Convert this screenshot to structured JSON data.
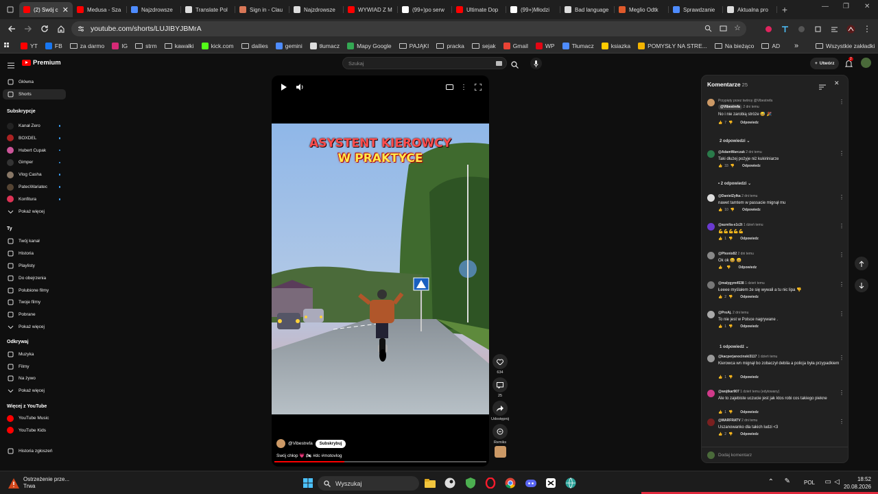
{
  "browser": {
    "tabs": [
      {
        "title": "(2) Swój c",
        "color": "#ff0000",
        "active": true
      },
      {
        "title": "Medusa - Sza",
        "color": "#ff0000"
      },
      {
        "title": "Najzdrowsze",
        "color": "#4e8cff"
      },
      {
        "title": "Translate Pol",
        "color": "#dddddd"
      },
      {
        "title": "Sign in - Clau",
        "color": "#d97757"
      },
      {
        "title": "Najzdrowsze",
        "color": "#dddddd"
      },
      {
        "title": "WYWIAD Z M",
        "color": "#ff0000"
      },
      {
        "title": "(99+)po serw",
        "color": "#ffffff"
      },
      {
        "title": "Ultimate Dop",
        "color": "#ff0000"
      },
      {
        "title": "(99+)Młodzi",
        "color": "#ffffff"
      },
      {
        "title": "Bad language",
        "color": "#dddddd"
      },
      {
        "title": "Meglio Odtk",
        "color": "#e05a2b"
      },
      {
        "title": "Sprawdzanie",
        "color": "#4e8cff"
      },
      {
        "title": "Aktualna pro",
        "color": "#dddddd"
      }
    ],
    "url": "youtube.com/shorts/LUJIBYJBMrA",
    "bookmarks": [
      {
        "label": "YT",
        "color": "#ff0000"
      },
      {
        "label": "FB",
        "color": "#1877f2"
      },
      {
        "label": "za darmo",
        "folder": true
      },
      {
        "label": "IG",
        "color": "#d62976"
      },
      {
        "label": "strm",
        "folder": true
      },
      {
        "label": "kawałki",
        "folder": true
      },
      {
        "label": "kick.com",
        "color": "#53fc18"
      },
      {
        "label": "dailies",
        "folder": true
      },
      {
        "label": "gemini",
        "color": "#4e8cff"
      },
      {
        "label": "tłumacz",
        "color": "#dddddd"
      },
      {
        "label": "Mapy Google",
        "color": "#34a853"
      },
      {
        "label": "PAJĄKI",
        "folder": true
      },
      {
        "label": "pracka",
        "folder": true
      },
      {
        "label": "sejak",
        "folder": true
      },
      {
        "label": "Gmail",
        "color": "#ea4335"
      },
      {
        "label": "WP",
        "color": "#e30613"
      },
      {
        "label": "Tłumacz",
        "color": "#4e8cff"
      },
      {
        "label": "ksiazka",
        "color": "#ffcc00"
      },
      {
        "label": "POMYSŁY NA STRE...",
        "color": "#f4b400"
      },
      {
        "label": "Na bieżąco",
        "folder": true
      },
      {
        "label": "AD",
        "folder": true
      }
    ],
    "all_bookmarks": "Wszystkie zakładki"
  },
  "youtube": {
    "logo": "Premium",
    "search_placeholder": "Szukaj",
    "create_label": "Utwórz",
    "notif_count": "2",
    "sidebar": {
      "main": [
        {
          "label": "Główna",
          "icon": "home-icon"
        },
        {
          "label": "Shorts",
          "icon": "shorts-icon",
          "active": true
        }
      ],
      "subs_header": "Subskrypcje",
      "subs": [
        {
          "label": "Kanał Zero",
          "color": "#222222"
        },
        {
          "label": "BOXDEL",
          "color": "#aa2222"
        },
        {
          "label": "Hubert Cupak",
          "color": "#cc5599"
        },
        {
          "label": "Gimper",
          "color": "#333333"
        },
        {
          "label": "Vlog Casha",
          "color": "#887766"
        },
        {
          "label": "PatecWariatec",
          "color": "#554433"
        },
        {
          "label": "Konfitura",
          "color": "#dd3355"
        }
      ],
      "show_more": "Pokaż więcej",
      "you_header": "Ty",
      "you": [
        "Twój kanał",
        "Historia",
        "Playlisty",
        "Do obejrzenia",
        "Polubione filmy",
        "Twoje filmy",
        "Pobrane",
        "Pokaż więcej"
      ],
      "explore_header": "Odkrywaj",
      "explore": [
        "Muzyka",
        "Filmy",
        "Na żywo",
        "Pokaż więcej"
      ],
      "more_header": "Więcej z YouTube",
      "more": [
        "YouTube Music",
        "YouTube Kids"
      ],
      "report": "Historia zgłoszeń"
    },
    "short": {
      "overlay_line1": "ASYSTENT KIEROWCY",
      "overlay_line2": "W PRAKTYCE",
      "channel": "@Vibestrefa",
      "subscribe": "Subskrybuj",
      "caption": "Swój chłop 💗 🏍 #dc #motovlog",
      "progress": 0.33,
      "likes": "634",
      "comments": "25",
      "share": "Udostępnij",
      "remix": "Remiks"
    },
    "comments": {
      "title": "Komentarze",
      "count": "25",
      "pinned": "Przypięty przez twórcę @Vibestrefa",
      "items": [
        {
          "author": "@Vibestrefa",
          "time": "2 dni temu",
          "text": "No i nie zarobią stróże 😅 🎉",
          "likes": "7",
          "color": "#c96"
        },
        {
          "author": "@AdamWarczak",
          "time": "2 dni temu",
          "text": "Taki dłużej pożyje niż kukiriniarze",
          "likes": "33",
          "color": "#2a7a4a"
        },
        {
          "author": "@DanielZyłka",
          "time": "2 dni temu",
          "text": "nawet tamtem w passacie mignął mu",
          "likes": "10",
          "color": "#ddd"
        },
        {
          "author": "@aurelia-s1c2t",
          "time": "1 dzień temu",
          "text": "💪💪💪💪💪",
          "likes": "1",
          "color": "#6a3ad0"
        },
        {
          "author": "@Phonix82",
          "time": "2 dni temu",
          "text": "Ok ok 😀 😀",
          "likes": "",
          "color": "#888"
        },
        {
          "author": "@malygym4538",
          "time": "1 dzień temu",
          "text": "Łeeee myślałem że się wywali a tu nic lipa 👎",
          "likes": "2",
          "color": "#777"
        },
        {
          "author": "@ProAj.",
          "time": "2 dni temu",
          "text": "To nie jest w Polsce nagrywane .",
          "likes": "1",
          "color": "#aaa"
        },
        {
          "author": "@kacperjanocinski3117",
          "time": "1 dzień temu",
          "text": "Kierowca wn mignął bo zobaczył debila a policja była przypadkiem",
          "likes": "1",
          "color": "#999"
        },
        {
          "author": "@wojtkar907",
          "time": "1 dzień temu (edytowany)",
          "text": "Ale to zajebiste uczucie jest jak ktos robi cos takiego piekne",
          "likes": "1",
          "color": "#d03a8a"
        },
        {
          "author": "@MARFRATV",
          "time": "2 dni temu",
          "text": "Uszanowanko dla takich ludzi <3",
          "likes": "2",
          "color": "#7a2020"
        }
      ],
      "reply_label": "Odpowiedz",
      "replies": [
        "2 odpowiedzi",
        "• 2 odpowiedzi",
        "1 odpowiedź"
      ],
      "add_placeholder": "Dodaj komentarz"
    }
  },
  "taskbar": {
    "notif_title": "Ostrzeżenie prze...",
    "notif_sub": "Trwa",
    "search": "Wyszukaj",
    "lang": "POL",
    "time": "18:52",
    "date": "20.08.2026"
  }
}
